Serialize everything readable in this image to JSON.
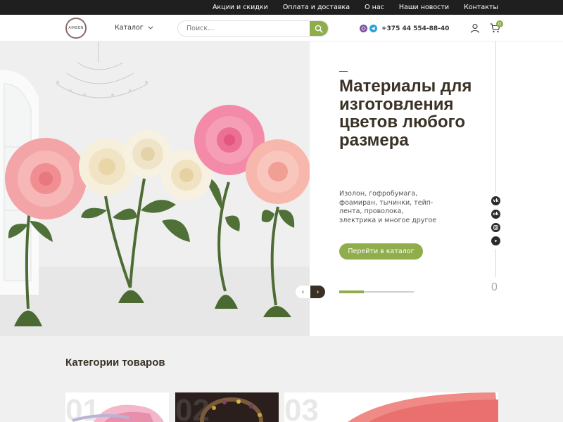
{
  "topnav": {
    "items": [
      "Акции и скидки",
      "Оплата и доставка",
      "О нас",
      "Наши новости",
      "Контакты"
    ]
  },
  "header": {
    "logo_text": "AIREEN",
    "catalog_label": "Каталог",
    "search_placeholder": "Поиск...",
    "phone": "+375 44 554-88-40",
    "cart_count": "0",
    "messenger_icons": [
      "viber-icon",
      "telegram-icon"
    ]
  },
  "hero": {
    "title": "Материалы для изготовления цветов любого размера",
    "subtitle": "Изолон, гофробумага, фоамиран, тычинки, тейп-лента, проволока, электрика и многое другое",
    "cta_label": "Перейти в каталог",
    "slide_number": "0",
    "progress": 0.33,
    "socials": [
      "vk-icon",
      "odnoklassniki-icon",
      "instagram-icon",
      "youtube-icon"
    ]
  },
  "categories": {
    "title": "Категории товаров",
    "cards": [
      {
        "num": "01"
      },
      {
        "num": "02"
      },
      {
        "num": "03"
      }
    ]
  },
  "colors": {
    "accent": "#8fae4b",
    "topbar": "#1f1f1f",
    "title": "#3a3226"
  }
}
